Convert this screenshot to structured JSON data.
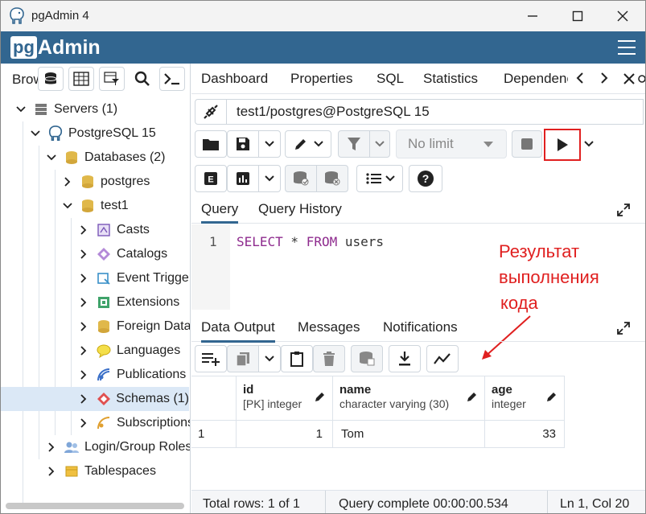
{
  "window": {
    "title": "pgAdmin 4"
  },
  "brand": {
    "pg": "pg",
    "admin": "Admin"
  },
  "left": {
    "browser_label": "Browser",
    "tree": [
      {
        "label": "Servers (1)",
        "icon": "servers-icon"
      },
      {
        "label": "PostgreSQL 15",
        "icon": "elephant-icon"
      },
      {
        "label": "Databases (2)",
        "icon": "databases-icon"
      },
      {
        "label": "postgres",
        "icon": "database-icon"
      },
      {
        "label": "test1",
        "icon": "database-icon"
      },
      {
        "label": "Casts",
        "icon": "casts-icon"
      },
      {
        "label": "Catalogs",
        "icon": "catalogs-icon"
      },
      {
        "label": "Event Triggers",
        "icon": "event-trigger-icon"
      },
      {
        "label": "Extensions",
        "icon": "extensions-icon"
      },
      {
        "label": "Foreign Data Wrappers",
        "icon": "foreign-data-icon"
      },
      {
        "label": "Languages",
        "icon": "languages-icon"
      },
      {
        "label": "Publications",
        "icon": "publications-icon"
      },
      {
        "label": "Schemas (1)",
        "icon": "schemas-icon"
      },
      {
        "label": "Subscriptions",
        "icon": "subscriptions-icon"
      },
      {
        "label": "Login/Group Roles",
        "icon": "roles-icon"
      },
      {
        "label": "Tablespaces",
        "icon": "tablespaces-icon"
      }
    ]
  },
  "tabs": [
    "Dashboard",
    "Properties",
    "SQL",
    "Statistics",
    "Dependencies"
  ],
  "connection": "test1/postgres@PostgreSQL 15",
  "limit": "No limit",
  "query_tabs": [
    "Query",
    "Query History"
  ],
  "editor": {
    "line": "1",
    "kw1": "SELECT",
    "star": " * ",
    "kw2": "FROM",
    "table": " users"
  },
  "annotation": [
    "Результат",
    "выполнения",
    "кода"
  ],
  "data_tabs": [
    "Data Output",
    "Messages",
    "Notifications"
  ],
  "columns": [
    {
      "name": "id",
      "type": "[PK] integer"
    },
    {
      "name": "name",
      "type": "character varying (30)"
    },
    {
      "name": "age",
      "type": "integer"
    }
  ],
  "rows": [
    {
      "num": "1",
      "id": "1",
      "name": "Tom",
      "age": "33"
    }
  ],
  "status": {
    "rows": "Total rows: 1 of 1",
    "query": "Query complete 00:00:00.534",
    "pos": "Ln 1, Col 20"
  },
  "colors": {
    "brand": "#326690",
    "annotation": "#e02020",
    "selected": "#dbe8f6"
  }
}
